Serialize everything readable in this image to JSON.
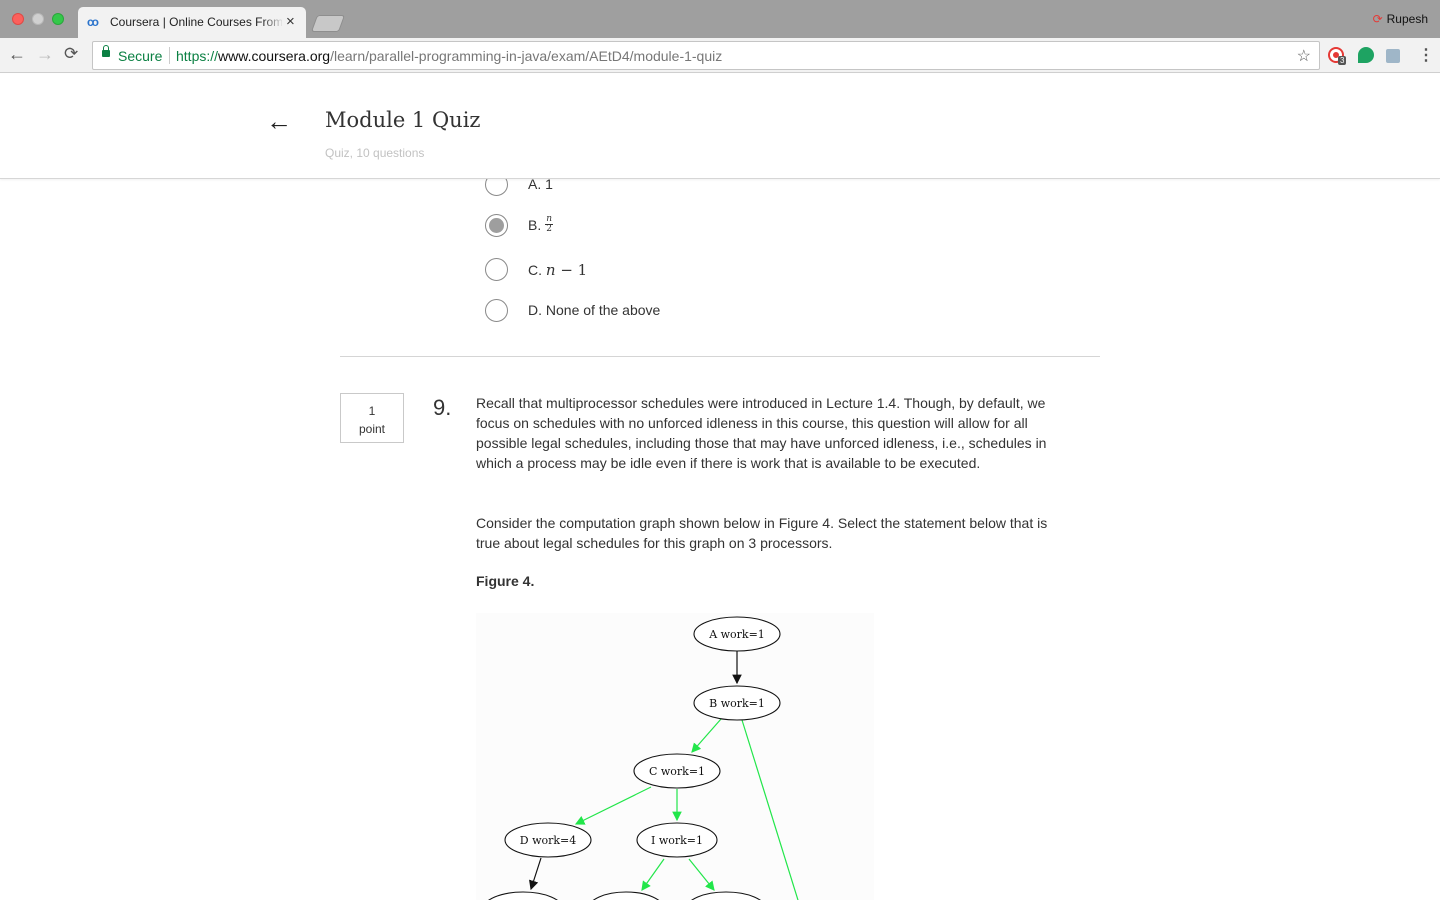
{
  "browser": {
    "tab_title": "Coursera | Online Courses From Top Universities. Join for Free",
    "tab_icon": "coursera-infinity-icon",
    "profile_name": "Rupesh",
    "secure_label": "Secure",
    "url_scheme": "https://",
    "url_host": "www.coursera.org",
    "url_path": "/learn/parallel-programming-in-java/exam/AEtD4/module-1-quiz",
    "extension_badge": "3"
  },
  "header": {
    "title": "Module 1 Quiz",
    "subtitle": "Quiz, 10 questions"
  },
  "previous_question": {
    "options": [
      {
        "label": "A. 1",
        "selected": false
      },
      {
        "label": "B.",
        "math_num": "n",
        "math_den": "2",
        "selected": true
      },
      {
        "label": "C.",
        "math": "n",
        "math_rest": " − 1",
        "selected": false
      },
      {
        "label": "D. None of the above",
        "selected": false
      }
    ]
  },
  "question": {
    "points_value": "1",
    "points_unit": "point",
    "number": "9.",
    "paragraph1": "Recall that multiprocessor schedules were introduced in Lecture 1.4. Though, by default, we focus on schedules with no unforced idleness in this course, this question will allow for all possible legal schedules, including those that may have unforced idleness, i.e., schedules in which a process may be idle even if there is work that is available to be executed.",
    "paragraph2": "Consider the computation graph shown below in Figure 4. Select the statement below that is true about legal schedules for this graph on 3 processors.",
    "figure_label": "Figure 4."
  },
  "graph": {
    "nodes": [
      {
        "id": "A",
        "label": "A work=1"
      },
      {
        "id": "B",
        "label": "B work=1"
      },
      {
        "id": "C",
        "label": "C work=1"
      },
      {
        "id": "D",
        "label": "D work=4"
      },
      {
        "id": "I",
        "label": "I work=1"
      }
    ],
    "edge_colors": {
      "normal": "#111111",
      "highlight": "#22e64a"
    }
  }
}
